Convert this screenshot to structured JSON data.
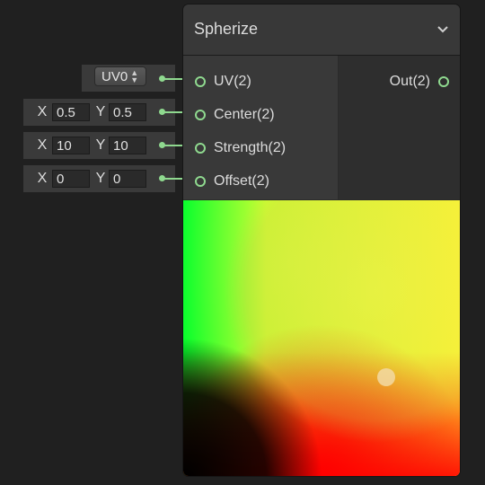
{
  "node": {
    "title": "Spherize",
    "inputs": [
      {
        "label": "UV(2)"
      },
      {
        "label": "Center(2)"
      },
      {
        "label": "Strength(2)"
      },
      {
        "label": "Offset(2)"
      }
    ],
    "outputs": [
      {
        "label": "Out(2)"
      }
    ]
  },
  "fields": {
    "uv": {
      "selected": "UV0"
    },
    "center": {
      "x_label": "X",
      "x": "0.5",
      "y_label": "Y",
      "y": "0.5"
    },
    "strength": {
      "x_label": "X",
      "x": "10",
      "y_label": "Y",
      "y": "10"
    },
    "offset": {
      "x_label": "X",
      "x": "0",
      "y_label": "Y",
      "y": "0"
    }
  },
  "colors": {
    "port": "#8fd98f",
    "node_header": "#383838",
    "background": "#202020"
  },
  "icons": {
    "collapse": "chevron-down-icon",
    "dropdown": "updown-arrows-icon"
  }
}
